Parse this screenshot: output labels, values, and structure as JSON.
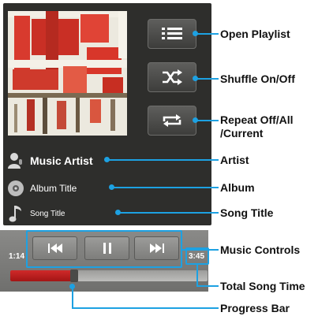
{
  "player": {
    "artist": "Music Artist",
    "album": "Album Title",
    "song": "Song Title",
    "elapsed_time": "1:14",
    "total_time": "3:45",
    "progress_fraction": 0.31,
    "buttons": [
      "playlist-icon",
      "shuffle-icon",
      "repeat-icon"
    ],
    "controls": [
      "previous-icon",
      "pause-icon",
      "next-icon"
    ]
  },
  "callouts": {
    "open_playlist": "Open Playlist",
    "shuffle": "Shuffle On/Off",
    "repeat_line1": "Repeat Off/All",
    "repeat_line2": "/Current",
    "artist": "Artist",
    "album": "Album",
    "song_title": "Song Title",
    "music_controls": "Music Controls",
    "total_song_time": "Total Song Time",
    "progress_bar": "Progress Bar"
  },
  "colors": {
    "accent": "#1da1e2",
    "progress": "#c01f1f",
    "screen_bg": "#2e2e2c"
  }
}
